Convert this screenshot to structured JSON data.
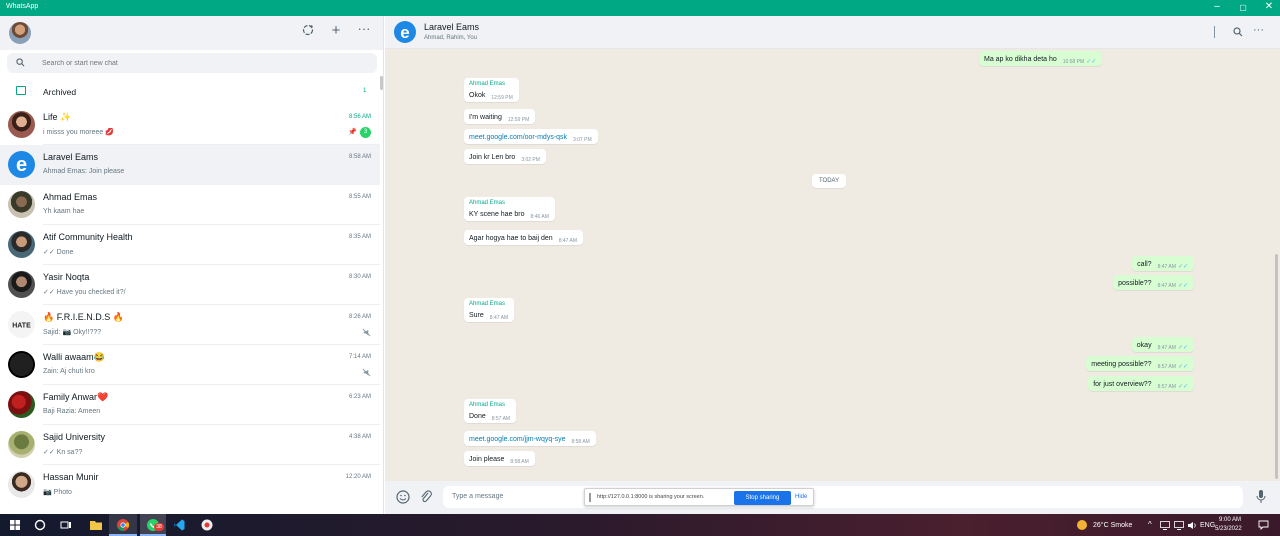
{
  "window": {
    "title": "WhatsApp"
  },
  "sidebar": {
    "search_placeholder": "Search or start new chat",
    "archived": {
      "label": "Archived",
      "count": "1"
    },
    "chats": [
      {
        "name": "Life ✨",
        "preview": "i misss you moreee 💋",
        "time": "8:56 AM",
        "time_green": true,
        "unread": "3",
        "pinned": true
      },
      {
        "name": "Laravel Eams",
        "preview": "Ahmad Emas: Join please",
        "time": "8:58 AM",
        "selected": true
      },
      {
        "name": "Ahmad Emas",
        "preview": "Yh kaam hae",
        "time": "8:55 AM"
      },
      {
        "name": "Atif Community Health",
        "preview": "✓✓ Done",
        "time": "8:35 AM"
      },
      {
        "name": "Yasir Noqta",
        "preview": "✓✓ Have you checked it?/",
        "time": "8:30 AM"
      },
      {
        "name": "🔥 F.R.I.E.N.D.S 🔥",
        "preview": "Sajid: 📷 Oky!!???",
        "time": "8:26 AM",
        "muted": true
      },
      {
        "name": "Walli awaam😂",
        "preview": "Zain: Aj chuti kro",
        "time": "7:14 AM",
        "muted": true
      },
      {
        "name": "Family Anwar❤️",
        "preview": "Baji Razia: Ameen",
        "time": "6:23 AM"
      },
      {
        "name": "Sajid University",
        "preview": "✓✓ Kn sa??",
        "time": "4:38 AM"
      },
      {
        "name": "Hassan Munir",
        "preview": "📷 Photo",
        "time": "12:20 AM"
      }
    ]
  },
  "conversation": {
    "title": "Laravel Eams",
    "subtitle": "Ahmad, Rahim, You",
    "day_label": "TODAY",
    "messages": [
      {
        "dir": "out",
        "text": "Ma ap ko dikha deta ho",
        "time": "10:58 PM",
        "check": "✓✓"
      },
      {
        "dir": "in",
        "sender": "Ahmad Emas",
        "text": "Okok",
        "time": "12:59 PM"
      },
      {
        "dir": "in",
        "text": "I'm waiting",
        "time": "12:59 PM"
      },
      {
        "dir": "in",
        "text": "meet.google.com/oor-mdys-qsk",
        "link": true,
        "time": "3:07 PM"
      },
      {
        "dir": "in",
        "text": "Join kr Len bro",
        "time": "3:02 PM"
      },
      {
        "dir": "in",
        "sender": "Ahmad Emas",
        "text": "KY scene hae bro",
        "time": "8:46 AM"
      },
      {
        "dir": "in",
        "text": "Agar hogya hae to baij den",
        "time": "8:47 AM"
      },
      {
        "dir": "out",
        "text": "call?",
        "time": "8:47 AM",
        "check": "✓✓"
      },
      {
        "dir": "out",
        "text": "possible??",
        "time": "8:47 AM",
        "check": "✓✓"
      },
      {
        "dir": "in",
        "sender": "Ahmad Emas",
        "text": "Sure",
        "time": "8:47 AM"
      },
      {
        "dir": "out",
        "text": "okay",
        "time": "8:47 AM",
        "check": "✓✓"
      },
      {
        "dir": "out",
        "text": "meeting possible??",
        "time": "8:57 AM",
        "check": "✓✓"
      },
      {
        "dir": "out",
        "text": "for just overview??",
        "time": "8:57 AM",
        "check": "✓✓"
      },
      {
        "dir": "in",
        "sender": "Ahmad Emas",
        "text": "Done",
        "time": "8:57 AM"
      },
      {
        "dir": "in",
        "text": "meet.google.com/jjm-wqyq-sye",
        "link": true,
        "time": "8:58 AM"
      },
      {
        "dir": "in",
        "text": "Join please",
        "time": "8:58 AM"
      }
    ]
  },
  "composer": {
    "placeholder": "Type a message"
  },
  "share_bar": {
    "message": "http://127.0.0.1:8000 is sharing your screen.",
    "stop_label": "Stop sharing",
    "hide_label": "Hide"
  },
  "taskbar": {
    "weather": "26°C Smoke",
    "time": "9:00 AM",
    "date": "5/23/2022",
    "chrome_badge": "38"
  },
  "colors": {
    "accent": "#00a884",
    "outgoing_bubble": "#d9fdd3",
    "chat_bg": "#efeae2",
    "link": "#027eb5"
  }
}
